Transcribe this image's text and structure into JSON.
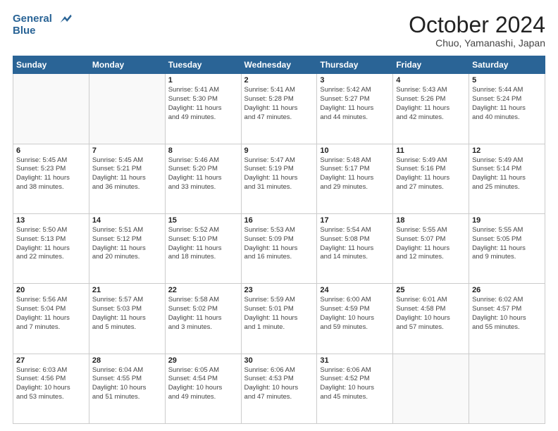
{
  "header": {
    "logo_line1": "General",
    "logo_line2": "Blue",
    "month": "October 2024",
    "location": "Chuo, Yamanashi, Japan"
  },
  "days_of_week": [
    "Sunday",
    "Monday",
    "Tuesday",
    "Wednesday",
    "Thursday",
    "Friday",
    "Saturday"
  ],
  "weeks": [
    [
      {
        "day": "",
        "detail": ""
      },
      {
        "day": "",
        "detail": ""
      },
      {
        "day": "1",
        "detail": "Sunrise: 5:41 AM\nSunset: 5:30 PM\nDaylight: 11 hours\nand 49 minutes."
      },
      {
        "day": "2",
        "detail": "Sunrise: 5:41 AM\nSunset: 5:28 PM\nDaylight: 11 hours\nand 47 minutes."
      },
      {
        "day": "3",
        "detail": "Sunrise: 5:42 AM\nSunset: 5:27 PM\nDaylight: 11 hours\nand 44 minutes."
      },
      {
        "day": "4",
        "detail": "Sunrise: 5:43 AM\nSunset: 5:26 PM\nDaylight: 11 hours\nand 42 minutes."
      },
      {
        "day": "5",
        "detail": "Sunrise: 5:44 AM\nSunset: 5:24 PM\nDaylight: 11 hours\nand 40 minutes."
      }
    ],
    [
      {
        "day": "6",
        "detail": "Sunrise: 5:45 AM\nSunset: 5:23 PM\nDaylight: 11 hours\nand 38 minutes."
      },
      {
        "day": "7",
        "detail": "Sunrise: 5:45 AM\nSunset: 5:21 PM\nDaylight: 11 hours\nand 36 minutes."
      },
      {
        "day": "8",
        "detail": "Sunrise: 5:46 AM\nSunset: 5:20 PM\nDaylight: 11 hours\nand 33 minutes."
      },
      {
        "day": "9",
        "detail": "Sunrise: 5:47 AM\nSunset: 5:19 PM\nDaylight: 11 hours\nand 31 minutes."
      },
      {
        "day": "10",
        "detail": "Sunrise: 5:48 AM\nSunset: 5:17 PM\nDaylight: 11 hours\nand 29 minutes."
      },
      {
        "day": "11",
        "detail": "Sunrise: 5:49 AM\nSunset: 5:16 PM\nDaylight: 11 hours\nand 27 minutes."
      },
      {
        "day": "12",
        "detail": "Sunrise: 5:49 AM\nSunset: 5:14 PM\nDaylight: 11 hours\nand 25 minutes."
      }
    ],
    [
      {
        "day": "13",
        "detail": "Sunrise: 5:50 AM\nSunset: 5:13 PM\nDaylight: 11 hours\nand 22 minutes."
      },
      {
        "day": "14",
        "detail": "Sunrise: 5:51 AM\nSunset: 5:12 PM\nDaylight: 11 hours\nand 20 minutes."
      },
      {
        "day": "15",
        "detail": "Sunrise: 5:52 AM\nSunset: 5:10 PM\nDaylight: 11 hours\nand 18 minutes."
      },
      {
        "day": "16",
        "detail": "Sunrise: 5:53 AM\nSunset: 5:09 PM\nDaylight: 11 hours\nand 16 minutes."
      },
      {
        "day": "17",
        "detail": "Sunrise: 5:54 AM\nSunset: 5:08 PM\nDaylight: 11 hours\nand 14 minutes."
      },
      {
        "day": "18",
        "detail": "Sunrise: 5:55 AM\nSunset: 5:07 PM\nDaylight: 11 hours\nand 12 minutes."
      },
      {
        "day": "19",
        "detail": "Sunrise: 5:55 AM\nSunset: 5:05 PM\nDaylight: 11 hours\nand 9 minutes."
      }
    ],
    [
      {
        "day": "20",
        "detail": "Sunrise: 5:56 AM\nSunset: 5:04 PM\nDaylight: 11 hours\nand 7 minutes."
      },
      {
        "day": "21",
        "detail": "Sunrise: 5:57 AM\nSunset: 5:03 PM\nDaylight: 11 hours\nand 5 minutes."
      },
      {
        "day": "22",
        "detail": "Sunrise: 5:58 AM\nSunset: 5:02 PM\nDaylight: 11 hours\nand 3 minutes."
      },
      {
        "day": "23",
        "detail": "Sunrise: 5:59 AM\nSunset: 5:01 PM\nDaylight: 11 hours\nand 1 minute."
      },
      {
        "day": "24",
        "detail": "Sunrise: 6:00 AM\nSunset: 4:59 PM\nDaylight: 10 hours\nand 59 minutes."
      },
      {
        "day": "25",
        "detail": "Sunrise: 6:01 AM\nSunset: 4:58 PM\nDaylight: 10 hours\nand 57 minutes."
      },
      {
        "day": "26",
        "detail": "Sunrise: 6:02 AM\nSunset: 4:57 PM\nDaylight: 10 hours\nand 55 minutes."
      }
    ],
    [
      {
        "day": "27",
        "detail": "Sunrise: 6:03 AM\nSunset: 4:56 PM\nDaylight: 10 hours\nand 53 minutes."
      },
      {
        "day": "28",
        "detail": "Sunrise: 6:04 AM\nSunset: 4:55 PM\nDaylight: 10 hours\nand 51 minutes."
      },
      {
        "day": "29",
        "detail": "Sunrise: 6:05 AM\nSunset: 4:54 PM\nDaylight: 10 hours\nand 49 minutes."
      },
      {
        "day": "30",
        "detail": "Sunrise: 6:06 AM\nSunset: 4:53 PM\nDaylight: 10 hours\nand 47 minutes."
      },
      {
        "day": "31",
        "detail": "Sunrise: 6:06 AM\nSunset: 4:52 PM\nDaylight: 10 hours\nand 45 minutes."
      },
      {
        "day": "",
        "detail": ""
      },
      {
        "day": "",
        "detail": ""
      }
    ]
  ]
}
